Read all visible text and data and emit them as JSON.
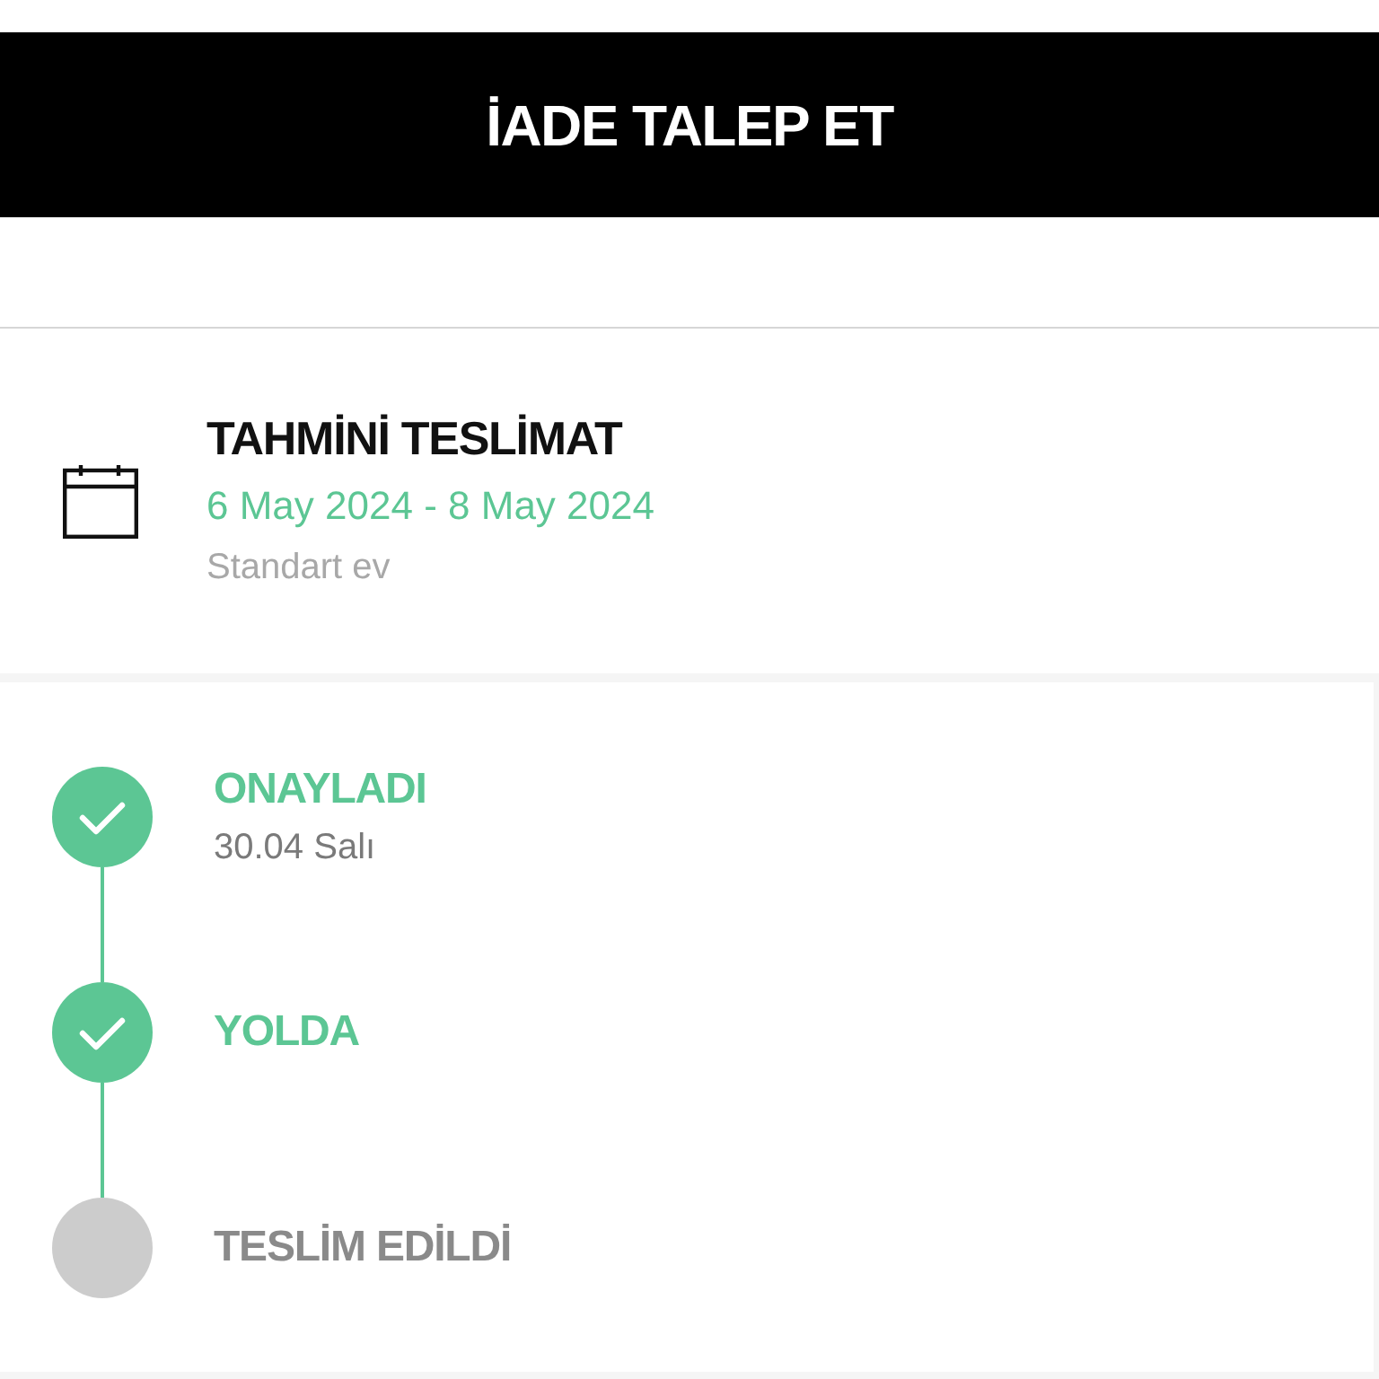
{
  "return_button": {
    "label": "İADE TALEP ET"
  },
  "delivery_estimate": {
    "title": "TAHMİNİ TESLİMAT",
    "date_range": "6 May 2024 - 8 May 2024",
    "method": "Standart ev"
  },
  "tracking_steps": [
    {
      "label": "ONAYLADI",
      "date": "30.04 Salı",
      "completed": true
    },
    {
      "label": "YOLDA",
      "completed": true
    },
    {
      "label": "TESLİM EDİLDİ",
      "completed": false
    }
  ]
}
